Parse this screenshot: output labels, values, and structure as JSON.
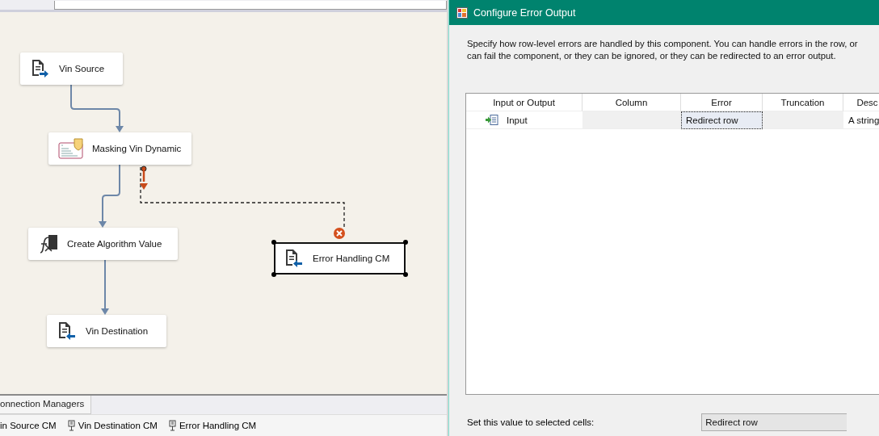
{
  "designer": {
    "nodes": [
      {
        "label": "Vin Source",
        "kind": "source",
        "selected": false
      },
      {
        "label": "Masking Vin Dynamic",
        "kind": "mask",
        "selected": false
      },
      {
        "label": "Create Algorithm Value",
        "kind": "derived",
        "selected": false
      },
      {
        "label": "Vin Destination",
        "kind": "destination",
        "selected": false
      },
      {
        "label": "Error Handling CM",
        "kind": "destination",
        "selected": true
      }
    ],
    "connection_managers_tab": "onnection Managers",
    "connection_managers": [
      {
        "label": "in Source CM"
      },
      {
        "label": "Vin Destination CM"
      },
      {
        "label": "Error Handling CM"
      }
    ]
  },
  "dialog": {
    "title": "Configure Error Output",
    "description_lines": [
      "Specify how row-level errors are handled by this component. You can handle errors in the row, or",
      "can fail the component, or they can be ignored, or they can be redirected to an error output."
    ],
    "grid": {
      "columns": [
        "Input or Output",
        "Column",
        "Error",
        "Truncation",
        "Desc"
      ],
      "rows": [
        {
          "input_or_output": "Input",
          "error": "Redirect row",
          "description": "A string",
          "error_selected": true
        }
      ]
    },
    "set_value_label": "Set this value to selected cells:",
    "set_value": "Redirect row"
  }
}
